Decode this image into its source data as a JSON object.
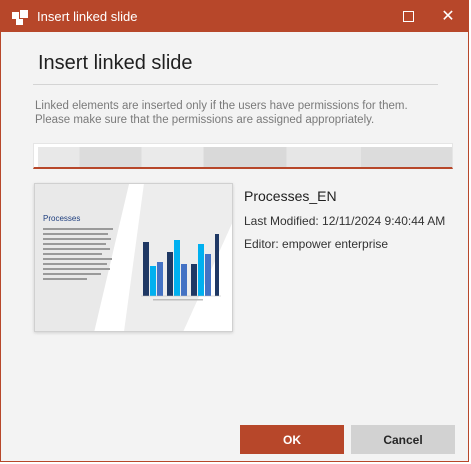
{
  "window": {
    "title": "Insert linked slide"
  },
  "dialog": {
    "heading": "Insert linked slide",
    "notice": "Linked elements are inserted only if the users have permissions for them. Please make sure that the permissions are assigned appropriately."
  },
  "search": {
    "value": "",
    "placeholder": ""
  },
  "slide": {
    "name": "Processes_EN",
    "last_modified": "Last Modified: 12/11/2024 9:40:44 AM",
    "editor": "Editor: empower enterprise",
    "thumbnail_title": "Processes"
  },
  "buttons": {
    "ok": "OK",
    "cancel": "Cancel"
  },
  "colors": {
    "accent": "#b7472a",
    "dark_blue": "#1f3864",
    "light_blue": "#00b0f0",
    "mid_blue": "#4472c4"
  },
  "icons": {
    "app": "app-logo-icon",
    "maximize": "maximize-icon",
    "close": "close-icon"
  }
}
